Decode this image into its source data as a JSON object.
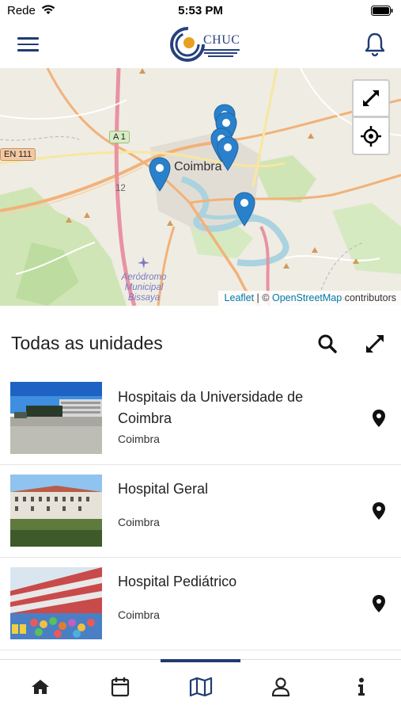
{
  "status_bar": {
    "carrier": "Rede",
    "time": "5:53 PM"
  },
  "header": {
    "logo_text": "CHUC",
    "icons": [
      "hamburger-menu-icon",
      "bell-icon"
    ]
  },
  "map": {
    "city_label": "Coimbra",
    "road_labels": [
      "A 1",
      "EN 111",
      "12"
    ],
    "place_label": "Aeródromo Municipal Bissaya",
    "attribution_leaflet": "Leaflet",
    "attribution_sep": " | © ",
    "attribution_osm": "OpenStreetMap",
    "attribution_tail": " contributors",
    "marker_color": "#2a81cb",
    "controls": [
      "fullscreen-icon",
      "locate-icon"
    ]
  },
  "section": {
    "title": "Todas as unidades"
  },
  "units": [
    {
      "name": "Hospitais da Universidade de Coimbra",
      "city": "Coimbra"
    },
    {
      "name": "Hospital Geral",
      "city": "Coimbra"
    },
    {
      "name": "Hospital Pediátrico",
      "city": "Coimbra"
    }
  ],
  "bottom_nav": {
    "items": [
      "home-icon",
      "calendar-icon",
      "map-icon",
      "user-icon",
      "info-icon"
    ],
    "active": "map-icon"
  },
  "colors": {
    "brand": "#1f3b73",
    "marker": "#2a81cb"
  }
}
